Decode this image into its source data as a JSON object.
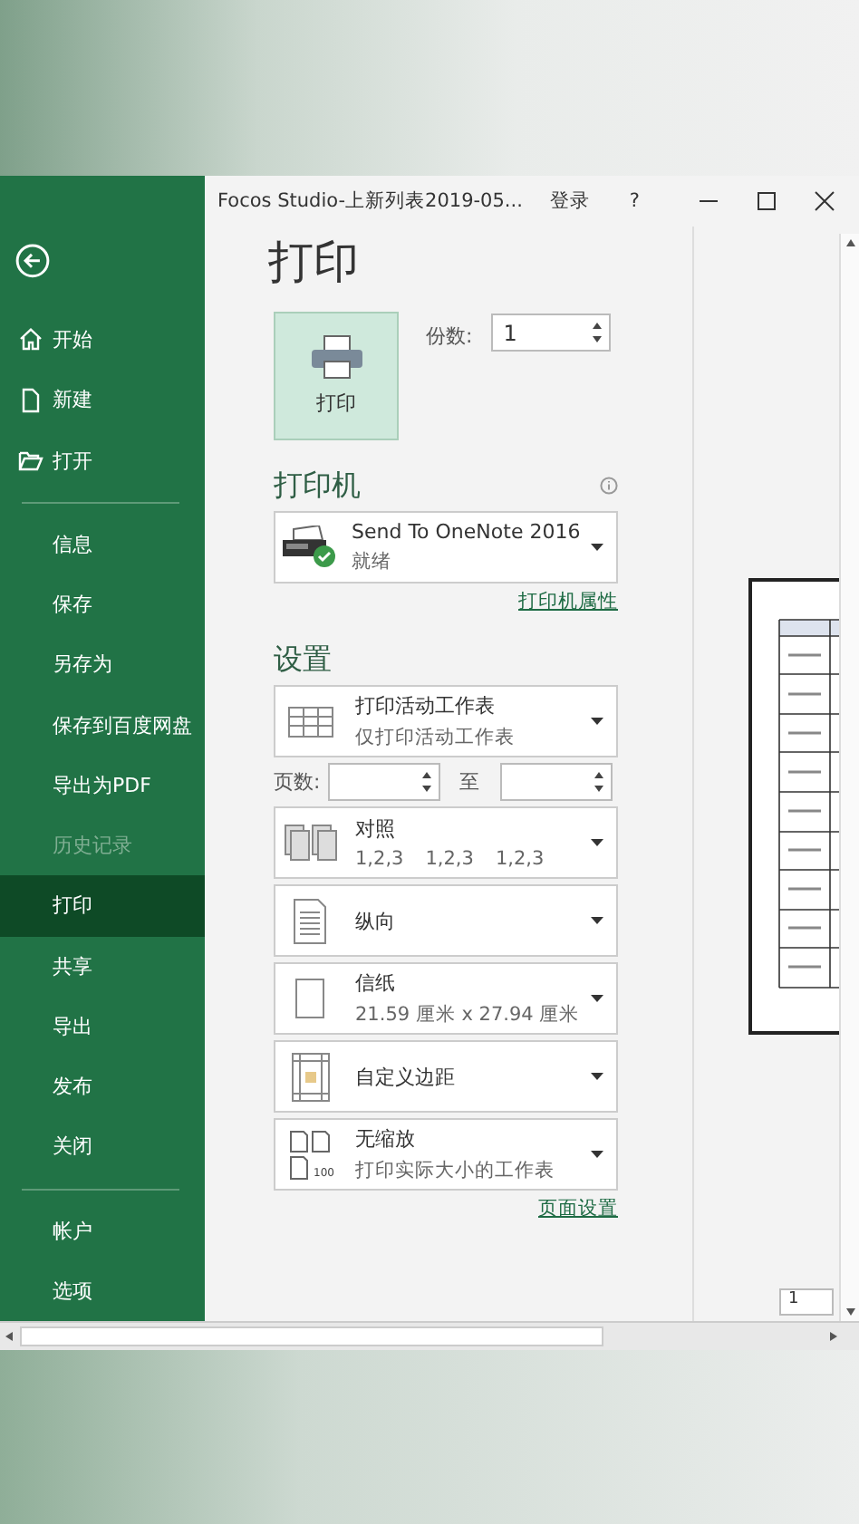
{
  "window": {
    "title": "Focos Studio-上新列表2019-05...",
    "sign_in": "登录",
    "help": "?"
  },
  "sidebar": {
    "groups": [
      [
        {
          "label": "开始",
          "kind": "home",
          "selected": false,
          "disabled": false
        },
        {
          "label": "新建",
          "kind": "new",
          "selected": false,
          "disabled": false
        },
        {
          "label": "打开",
          "kind": "open",
          "selected": false,
          "disabled": false
        }
      ],
      [
        {
          "label": "信息",
          "kind": "plain",
          "selected": false,
          "disabled": false
        },
        {
          "label": "保存",
          "kind": "plain",
          "selected": false,
          "disabled": false
        },
        {
          "label": "另存为",
          "kind": "plain",
          "selected": false,
          "disabled": false
        },
        {
          "label": "保存到百度网盘",
          "kind": "plain",
          "selected": false,
          "disabled": false
        },
        {
          "label": "导出为PDF",
          "kind": "plain",
          "selected": false,
          "disabled": false
        },
        {
          "label": "历史记录",
          "kind": "plain",
          "selected": false,
          "disabled": true
        },
        {
          "label": "打印",
          "kind": "plain",
          "selected": true,
          "disabled": false
        },
        {
          "label": "共享",
          "kind": "plain",
          "selected": false,
          "disabled": false
        },
        {
          "label": "导出",
          "kind": "plain",
          "selected": false,
          "disabled": false
        },
        {
          "label": "发布",
          "kind": "plain",
          "selected": false,
          "disabled": false
        },
        {
          "label": "关闭",
          "kind": "plain",
          "selected": false,
          "disabled": false
        }
      ],
      [
        {
          "label": "帐户",
          "kind": "plain",
          "selected": false,
          "disabled": false
        },
        {
          "label": "选项",
          "kind": "plain",
          "selected": false,
          "disabled": false
        }
      ]
    ]
  },
  "page_title": "打印",
  "print_button": "打印",
  "copies": {
    "label": "份数:",
    "value": "1"
  },
  "printer": {
    "heading": "打印机",
    "name": "Send To OneNote 2016",
    "status": "就绪",
    "properties_link": "打印机属性"
  },
  "settings": {
    "heading": "设置",
    "items": [
      {
        "kind": "sheet",
        "title": "打印活动工作表",
        "subtitle": "仅打印活动工作表"
      },
      {
        "kind": "pages",
        "label": "页数:",
        "to": "至"
      },
      {
        "kind": "collate",
        "title": "对照",
        "parts": [
          "1,2,3",
          "1,2,3",
          "1,2,3"
        ]
      },
      {
        "kind": "portrait",
        "title": "纵向"
      },
      {
        "kind": "paper",
        "title": "信纸",
        "subtitle": "21.59 厘米 x 27.94 厘米"
      },
      {
        "kind": "margins",
        "title": "自定义边距"
      },
      {
        "kind": "scaling",
        "title": "无缩放",
        "subtitle": "打印实际大小的工作表",
        "icon_text": "100"
      }
    ],
    "page_setup_link": "页面设置"
  },
  "preview": {
    "page_number": "1"
  }
}
